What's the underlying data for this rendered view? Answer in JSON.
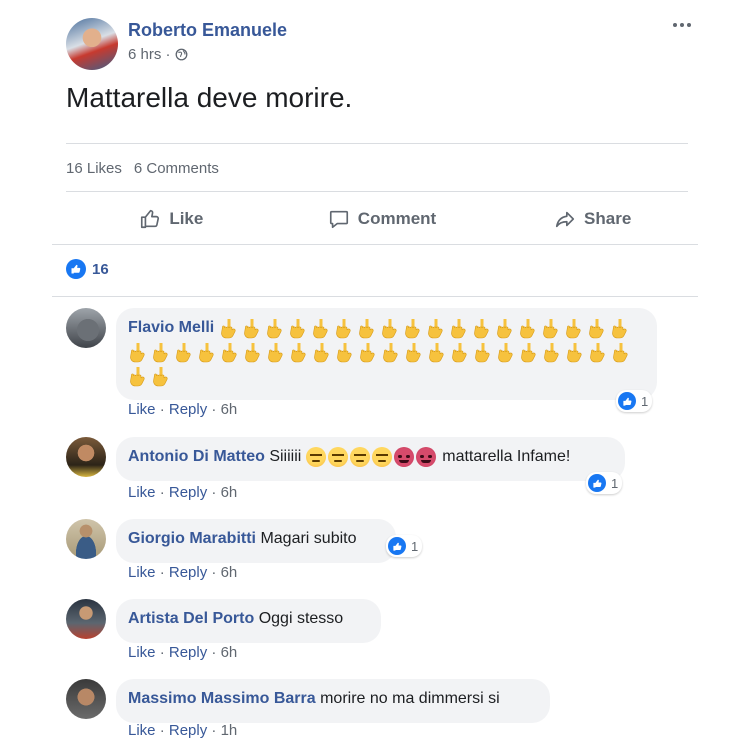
{
  "post": {
    "author": "Roberto Emanuele",
    "timestamp": "6 hrs ·",
    "text": "Mattarella deve morire.",
    "likes_label": "16 Likes",
    "comments_label": "6 Comments",
    "reaction_count": "16"
  },
  "actions": {
    "like": "Like",
    "comment": "Comment",
    "share": "Share"
  },
  "icons": {
    "more": "more-options-icon",
    "globe": "globe-icon",
    "like": "thumbs-up-icon",
    "comment": "speech-bubble-icon",
    "share": "share-arrow-icon",
    "middle_finger": "middle-finger-emoji",
    "angry": "angry-face-emoji",
    "devil": "devil-face-emoji"
  },
  "colors": {
    "link": "#385898",
    "like_blue": "#1877f2",
    "bubble_bg": "#f2f3f5",
    "muted": "#606770"
  },
  "comments": [
    {
      "name": "Flavio Melli",
      "text": "",
      "emoji_count": 42,
      "meta": {
        "like": "Like",
        "reply": "Reply",
        "time": "6h"
      },
      "reactions": "1"
    },
    {
      "name": "Antonio Di Matteo",
      "text_before": "Siiiiii",
      "text_after": "mattarella Infame!",
      "meta": {
        "like": "Like",
        "reply": "Reply",
        "time": "6h"
      },
      "reactions": "1"
    },
    {
      "name": "Giorgio Marabitti",
      "text": "Magari subito",
      "meta": {
        "like": "Like",
        "reply": "Reply",
        "time": "6h"
      },
      "reactions": "1"
    },
    {
      "name": "Artista Del Porto",
      "text": "Oggi stesso",
      "meta": {
        "like": "Like",
        "reply": "Reply",
        "time": "6h"
      }
    },
    {
      "name": "Massimo Massimo Barra",
      "text": "morire no ma dimmersi si",
      "meta": {
        "like": "Like",
        "reply": "Reply",
        "time": "1h"
      }
    }
  ]
}
